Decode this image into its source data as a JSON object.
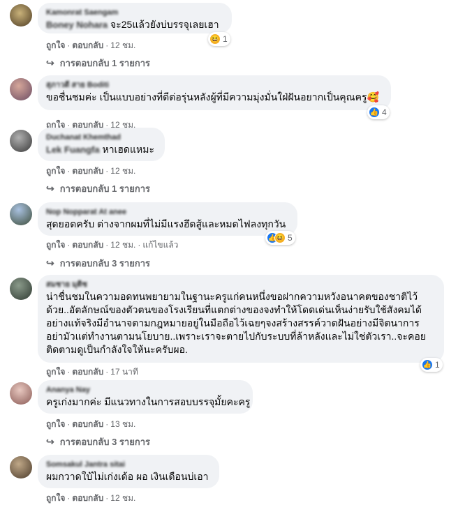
{
  "actions": {
    "like": "ถูกใจ",
    "reply": "ตอบกลับ",
    "dot": "·"
  },
  "comments": [
    {
      "mention": "Boney Nohara",
      "text": "จะ25แล้วยังบ่บรรจุเลยเฮา",
      "time": "12 ชม.",
      "reactions": "1",
      "replies": "การตอบกลับ 1 รายการ"
    },
    {
      "text": "ขอชื่นชมค่ะ เป็นแบบอย่างที่ดีต่อรุ่นหลังผู้ที่มีความมุ่งมั่นใฝ่ฝันอยากเป็นคุณครู",
      "emoji": "🥰",
      "time": "12 ชม.",
      "reactions": "4"
    },
    {
      "mention": "Lek Fuangfa",
      "text": "หาเฮดแหมะ",
      "time": "12 ชม.",
      "replies": "การตอบกลับ 1 รายการ"
    },
    {
      "text": "สุดยอดครับ ต่างจากผมที่ไม่มีแรงฮึดสู้และหมดไฟลงทุกวัน",
      "time": "12 ชม.",
      "edited": "แก้ไขแล้ว",
      "reactions": "5",
      "replies": "การตอบกลับ 3 รายการ"
    },
    {
      "lines": [
        "น่าชื่นชมในความอดทนพยายามในฐานะครูแก่คนหนึ่งขอฝากความหวังอนาคตของชาติไว้",
        "ด้วย..อัตลักษณ์ของตัวตนของโรงเรียนที่แตกต่างของจงทำให้โดดเด่นเห็นง่ายรับใช้สังคมได้",
        "อย่างแท้จริงมีอำนาจตามกฎหมายอยู่ในมือถือไว้เฉยๆจงสร้างสรรค์วาดฝันอย่างมีจิตนาการ",
        "อย่ามัวแต่ทำงานตามนโยบาย..เพราะเราจะตายไปกับระบบที่ล้าหลังและไม่ใช่ตัวเรา..จะคอย",
        "ติดตามดูเป็นกำลังใจให้นะครับผอ."
      ],
      "time": "17 นาที",
      "reactions": "1"
    },
    {
      "text": "ครูเก่งมากค่ะ มีแนวทางในการสอบบรรจุมั้ยคะครู",
      "time": "13 ชม.",
      "replies": "การตอบกลับ 3 รายการ"
    },
    {
      "text": "ผมกวาดใบ้ไม่เก่งเด้อ ผอ เงินเดือนบ่เอา",
      "time": "12 ชม."
    }
  ]
}
